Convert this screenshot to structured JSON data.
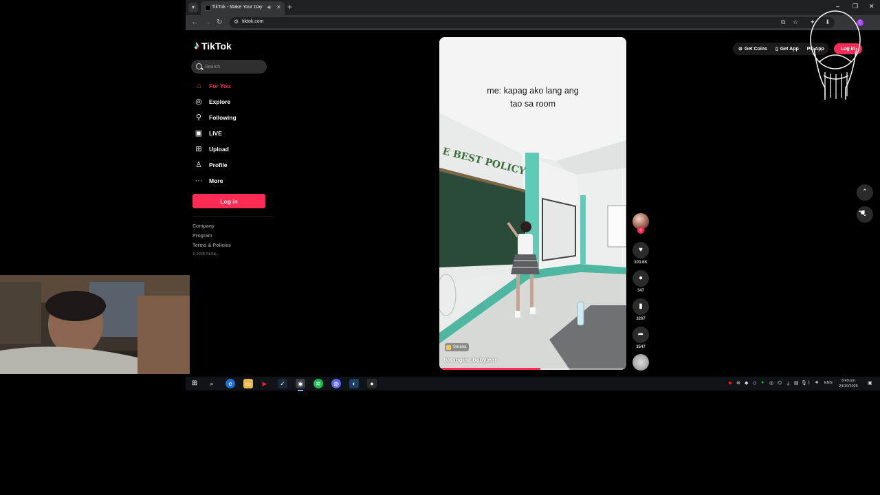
{
  "browser": {
    "tab_title": "TikTok - Make Your Day",
    "new_tab_symbol": "+",
    "url": "tiktok.com",
    "profile_initial": "C"
  },
  "sidebar": {
    "logo_text": "TikTok",
    "search_placeholder": "Search",
    "nav": [
      {
        "label": "For You",
        "icon": "home-icon",
        "active": true
      },
      {
        "label": "Explore",
        "icon": "compass-icon"
      },
      {
        "label": "Following",
        "icon": "following-icon"
      },
      {
        "label": "LIVE",
        "icon": "live-tv-icon"
      },
      {
        "label": "Upload",
        "icon": "upload-icon"
      },
      {
        "label": "Profile",
        "icon": "profile-icon"
      },
      {
        "label": "More",
        "icon": "more-dots-icon"
      }
    ],
    "login_label": "Log in",
    "footer_links": [
      "Company",
      "Program",
      "Terms & Policies"
    ],
    "copyright": "© 2025 TikTok"
  },
  "video": {
    "caption_line1": "me: kapag ako lang ang",
    "caption_line2": "tao sa room",
    "music_tag": "Serana",
    "author": "batangina.babyjean",
    "progress_fraction": 0.54
  },
  "actions": {
    "likes": "103.6K",
    "comments": "347",
    "bookmarks": "3267",
    "shares": "3547"
  },
  "top_actions": {
    "get_coins": "Get Coins",
    "get_app": "Get App",
    "pc_app": "PC App",
    "login": "Log in"
  },
  "taskbar": {
    "language": "ENG",
    "time": "8:49 pm",
    "date": "24/10/2025"
  },
  "colors": {
    "accent": "#fe2c55",
    "background": "#000000"
  }
}
